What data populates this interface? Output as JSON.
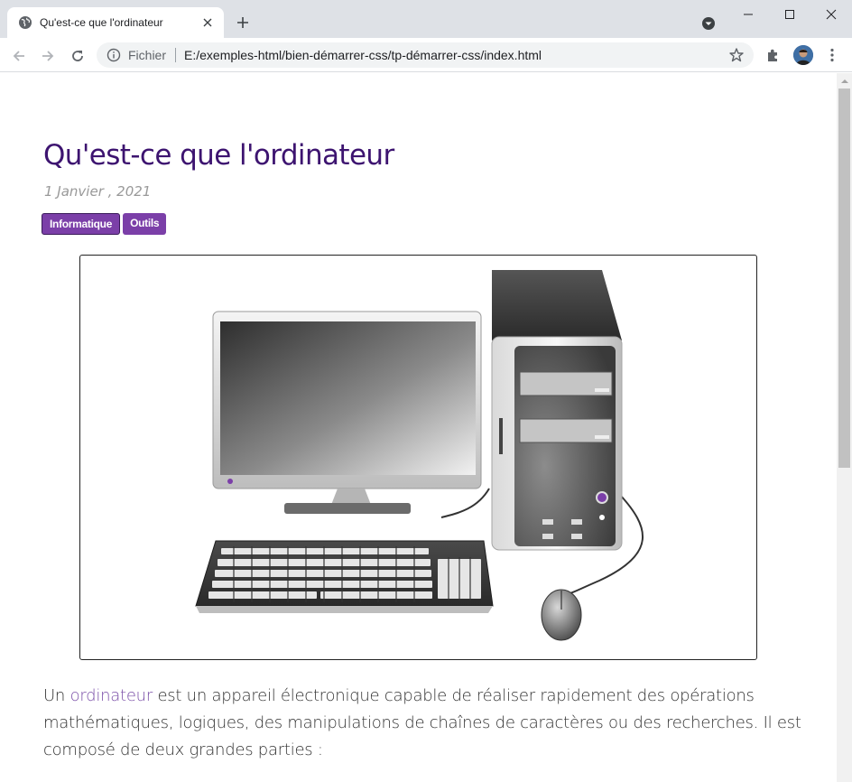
{
  "browser": {
    "tab_title": "Qu'est-ce que l'ordinateur",
    "scheme_label": "Fichier",
    "url": "E:/exemples-html/bien-démarrer-css/tp-démarrer-css/index.html"
  },
  "article": {
    "title": "Qu'est-ce que l'ordinateur",
    "date": "1 Janvier , 2021",
    "tags": [
      "Informatique",
      "Outils"
    ],
    "paragraph": {
      "before_link": "Un ",
      "link_text": "ordinateur",
      "after_link": " est un appareil électronique capable de réaliser rapidement des opérations mathématiques, logiques, des manipulations de chaînes de caractères ou des recherches. Il est composé de deux grandes parties :"
    }
  },
  "colors": {
    "title": "#3d1470",
    "tag_bg": "#7b3fa8",
    "link": "#7b4fa8",
    "text": "#333333",
    "date": "#999999"
  },
  "icons": [
    "globe-icon",
    "close-icon",
    "plus-icon",
    "tab-search-icon",
    "minimize-icon",
    "maximize-icon",
    "window-close-icon",
    "back-arrow-icon",
    "forward-arrow-icon",
    "reload-icon",
    "info-icon",
    "star-icon",
    "puzzle-icon",
    "avatar",
    "kebab-menu-icon"
  ]
}
